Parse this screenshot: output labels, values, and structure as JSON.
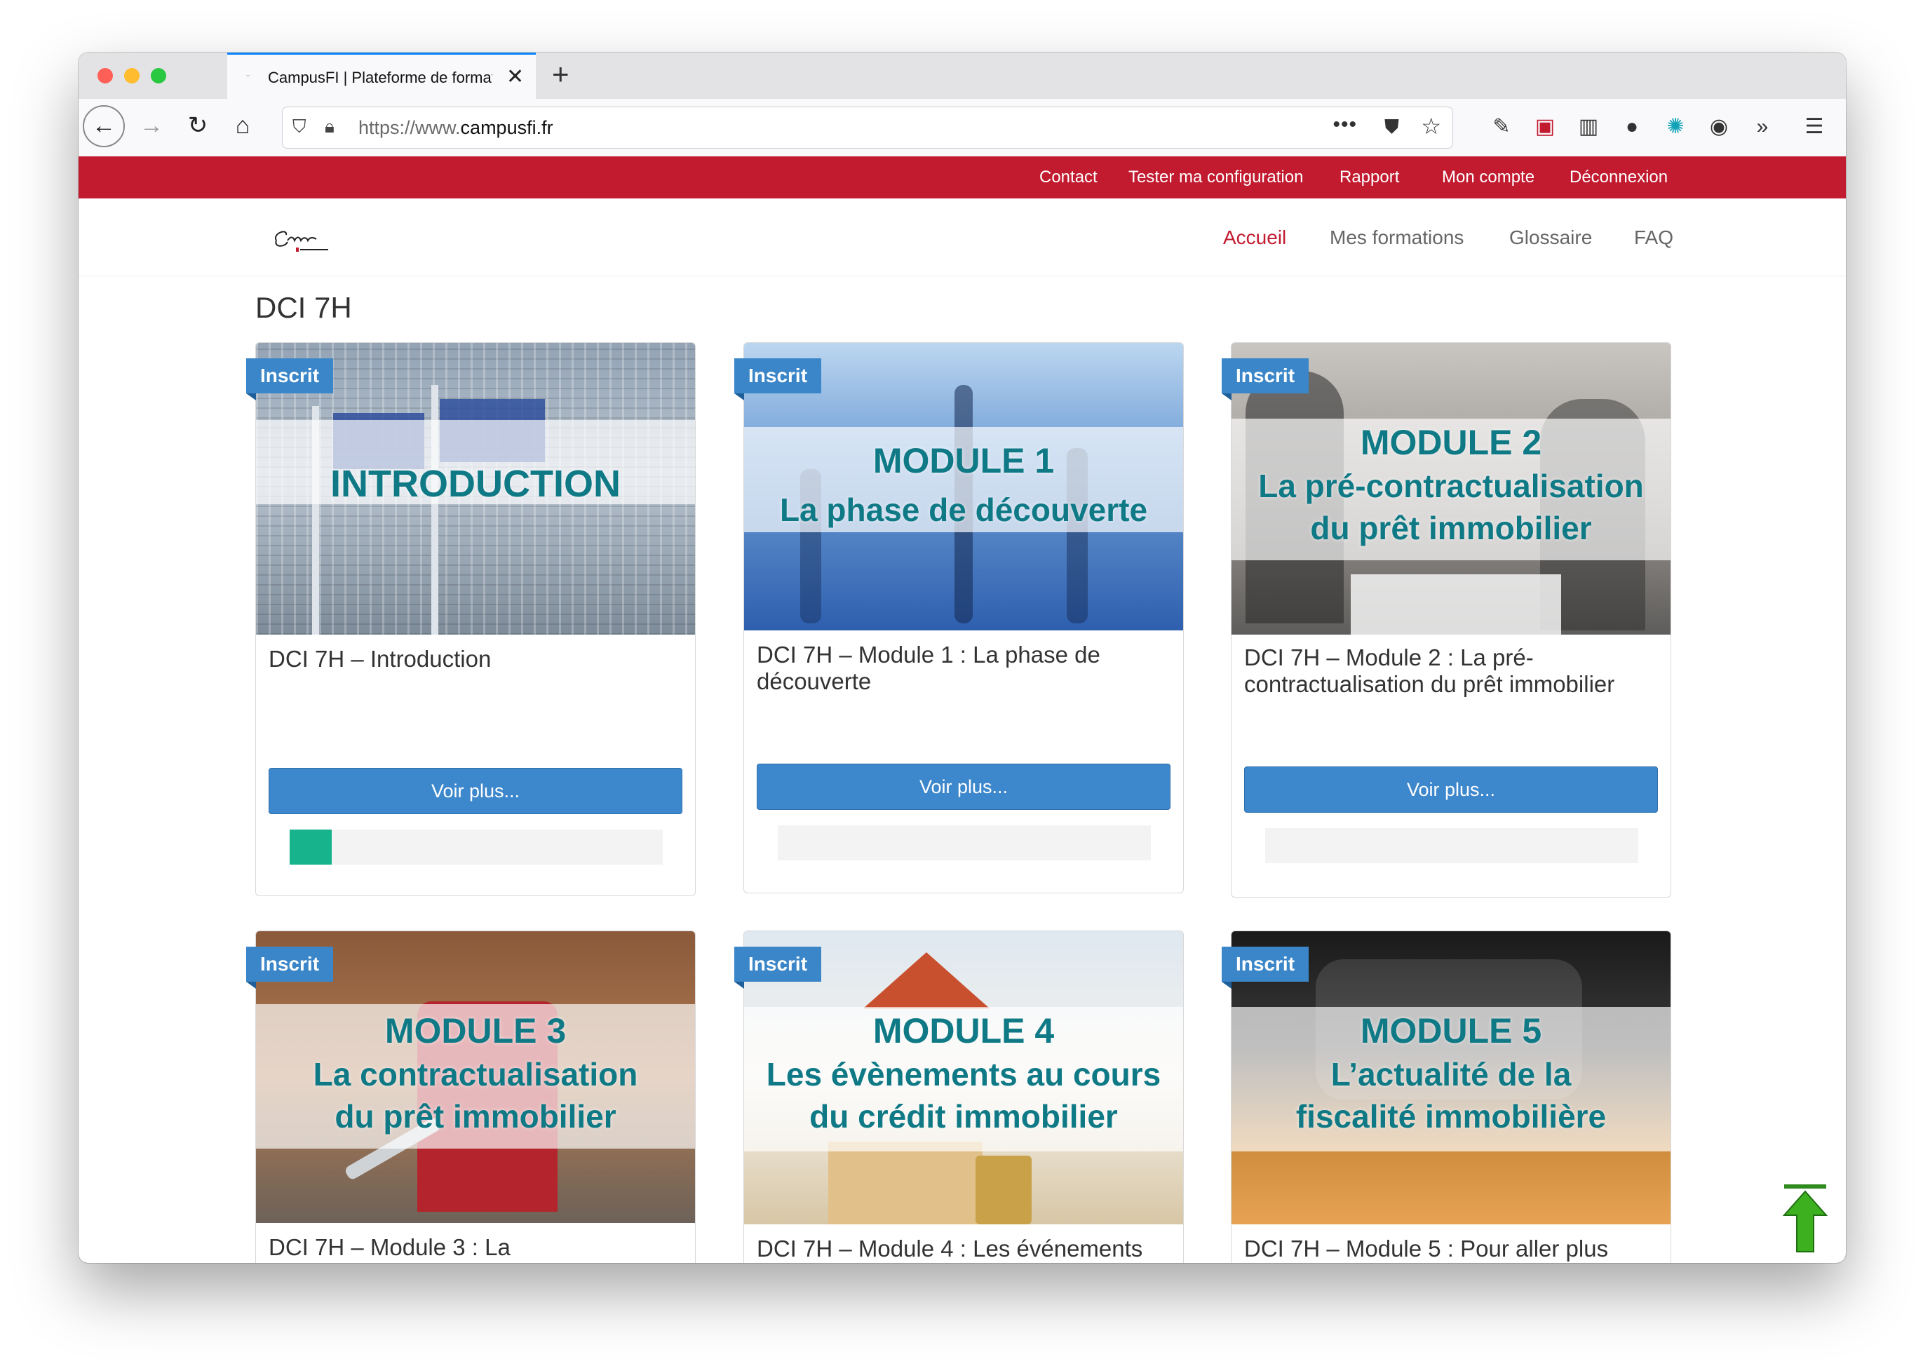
{
  "browser": {
    "tab_title": "CampusFI | Plateforme de formation",
    "url_prefix": "https://www.",
    "url_domain": "campusfi.fr",
    "icons": [
      "back-icon",
      "forward-icon",
      "reload-icon",
      "home-icon",
      "shield-icon",
      "lock-icon",
      "more-icon",
      "pocket-icon",
      "bookmark-star-icon",
      "eyedropper-icon",
      "pdf-icon",
      "reader-icon",
      "extension-icon",
      "react-icon",
      "account-icon",
      "overflow-icon",
      "menu-icon"
    ]
  },
  "topbar": {
    "links": [
      "Contact",
      "Tester ma configuration",
      "Rapport",
      "Mon compte",
      "Déconnexion"
    ]
  },
  "nav": {
    "items": [
      "Accueil",
      "Mes formations",
      "Glossaire",
      "FAQ"
    ],
    "active": "Accueil"
  },
  "page": {
    "title": "DCI 7H"
  },
  "cards": [
    {
      "badge": "Inscrit",
      "img_line1": "INTRODUCTION",
      "img_line2": "",
      "img_line3": "",
      "title": "DCI 7H – Introduction",
      "button": "Voir plus...",
      "progress": 0.06
    },
    {
      "badge": "Inscrit",
      "img_line1": "MODULE 1",
      "img_line2": "La phase de découverte",
      "img_line3": "",
      "title": "DCI 7H – Module 1 : La phase de découverte",
      "button": "Voir plus...",
      "progress": 0
    },
    {
      "badge": "Inscrit",
      "img_line1": "MODULE 2",
      "img_line2": "La pré-contractualisation",
      "img_line3": "du prêt immobilier",
      "title": "DCI 7H – Module 2 : La pré-contractualisation du prêt immobilier",
      "button": "Voir plus...",
      "progress": 0
    },
    {
      "badge": "Inscrit",
      "img_line1": "MODULE 3",
      "img_line2": "La contractualisation",
      "img_line3": "du prêt immobilier",
      "title": "DCI 7H – Module 3 : La",
      "button": "",
      "progress": 0
    },
    {
      "badge": "Inscrit",
      "img_line1": "MODULE 4",
      "img_line2": "Les évènements au cours",
      "img_line3": "du crédit immobilier",
      "title": "DCI 7H – Module 4 : Les événements",
      "button": "",
      "progress": 0
    },
    {
      "badge": "Inscrit",
      "img_line1": "MODULE 5",
      "img_line2": "L’actualité de la",
      "img_line3": "fiscalité immobilière",
      "title": "DCI 7H – Module 5 : Pour aller plus",
      "button": "",
      "progress": 0
    }
  ],
  "colors": {
    "brand_red": "#c21b30",
    "button_blue": "#3d87cc",
    "badge_blue": "#3a86c8",
    "progress_green": "#17b38c",
    "module_teal": "#0f7a86"
  }
}
